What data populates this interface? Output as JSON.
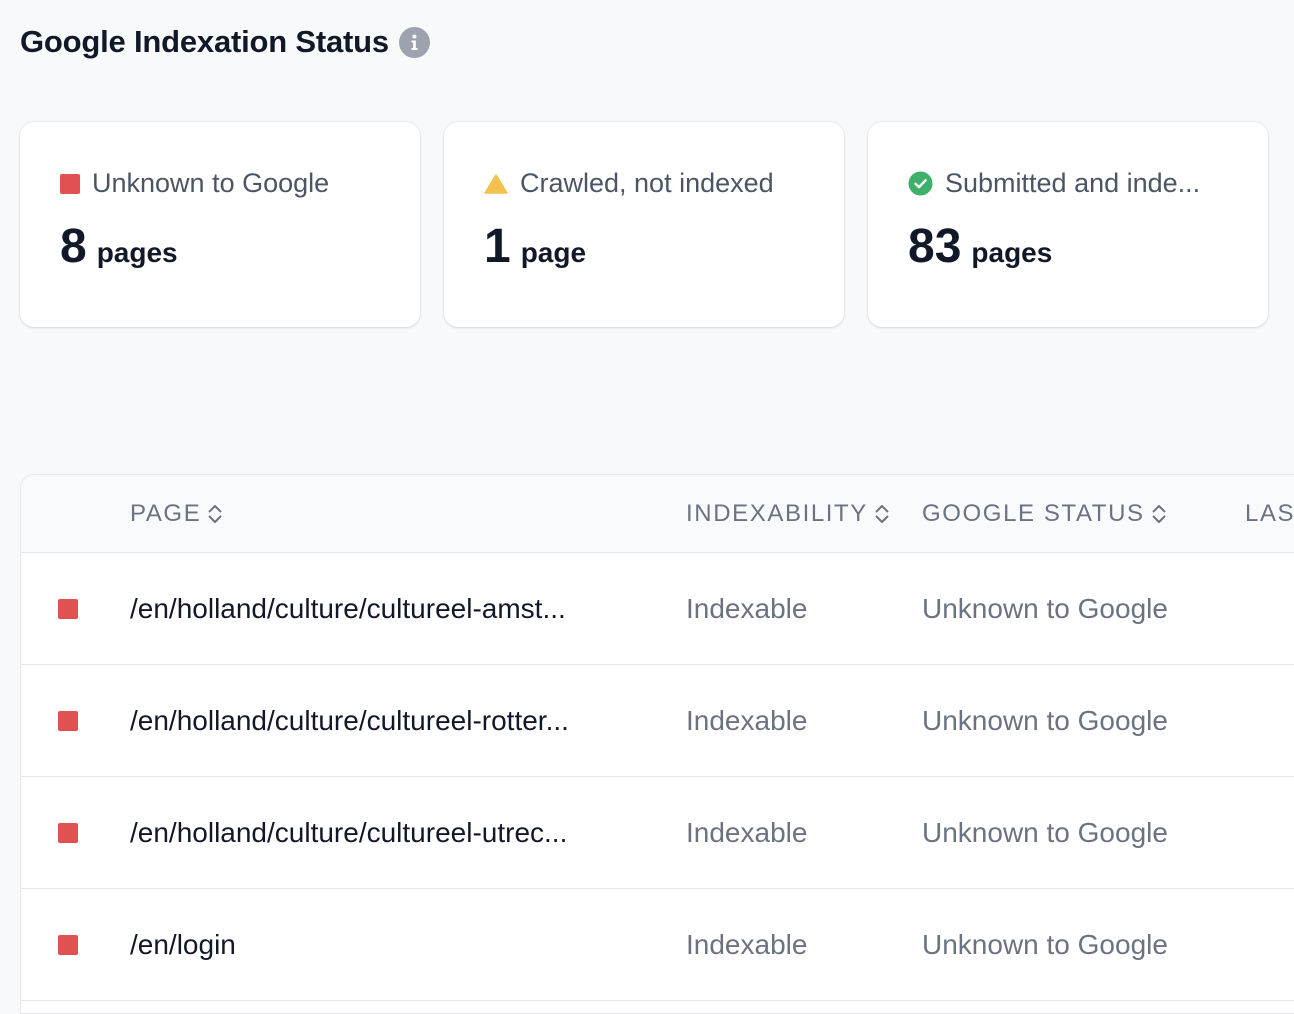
{
  "header": {
    "title": "Google Indexation Status",
    "info_icon": "info-icon"
  },
  "cards": [
    {
      "label": "Unknown to Google",
      "icon": "red-square-icon",
      "value": "8",
      "unit": "pages",
      "color": "#e05252"
    },
    {
      "label": "Crawled, not indexed",
      "icon": "warning-triangle-icon",
      "value": "1",
      "unit": "page",
      "color": "#f2c14e"
    },
    {
      "label": "Submitted and inde...",
      "icon": "check-circle-icon",
      "value": "83",
      "unit": "pages",
      "color": "#3fb06a"
    }
  ],
  "table": {
    "columns": {
      "page": "PAGE",
      "indexability": "INDEXABILITY",
      "google_status": "GOOGLE STATUS",
      "last": "LAS"
    },
    "rows": [
      {
        "page": "/en/holland/culture/cultureel-amst...",
        "indexability": "Indexable",
        "google_status": "Unknown to Google"
      },
      {
        "page": "/en/holland/culture/cultureel-rotter...",
        "indexability": "Indexable",
        "google_status": "Unknown to Google"
      },
      {
        "page": "/en/holland/culture/cultureel-utrec...",
        "indexability": "Indexable",
        "google_status": "Unknown to Google"
      },
      {
        "page": "/en/login",
        "indexability": "Indexable",
        "google_status": "Unknown to Google"
      }
    ]
  }
}
